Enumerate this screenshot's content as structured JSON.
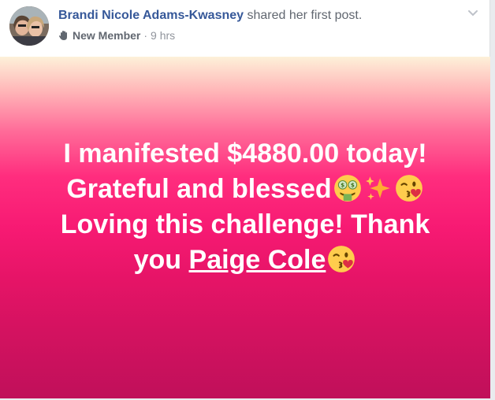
{
  "post": {
    "author_name": "Brandi Nicole Adams-Kwasney",
    "action_text": " shared her first post.",
    "badge": "New Member",
    "separator": "·",
    "timestamp": "9 hrs",
    "icons": {
      "member": "new-member-wave-icon",
      "menu": "chevron-down-icon"
    },
    "colors": {
      "author_link": "#365899",
      "gradient_top": "#fdf1d9",
      "gradient_mid": "#ff2d7e",
      "gradient_bottom": "#c0105a",
      "text": "#ffffff"
    },
    "body": {
      "line1": "I manifested $4880.00 today!",
      "line2": "Grateful and blessed",
      "line3": "Loving this challenge! Thank",
      "line4_prefix": "you ",
      "mention": "Paige Cole",
      "emojis": [
        "money-mouth-face",
        "sparkles",
        "face-blowing-kiss",
        "face-blowing-kiss"
      ]
    }
  }
}
